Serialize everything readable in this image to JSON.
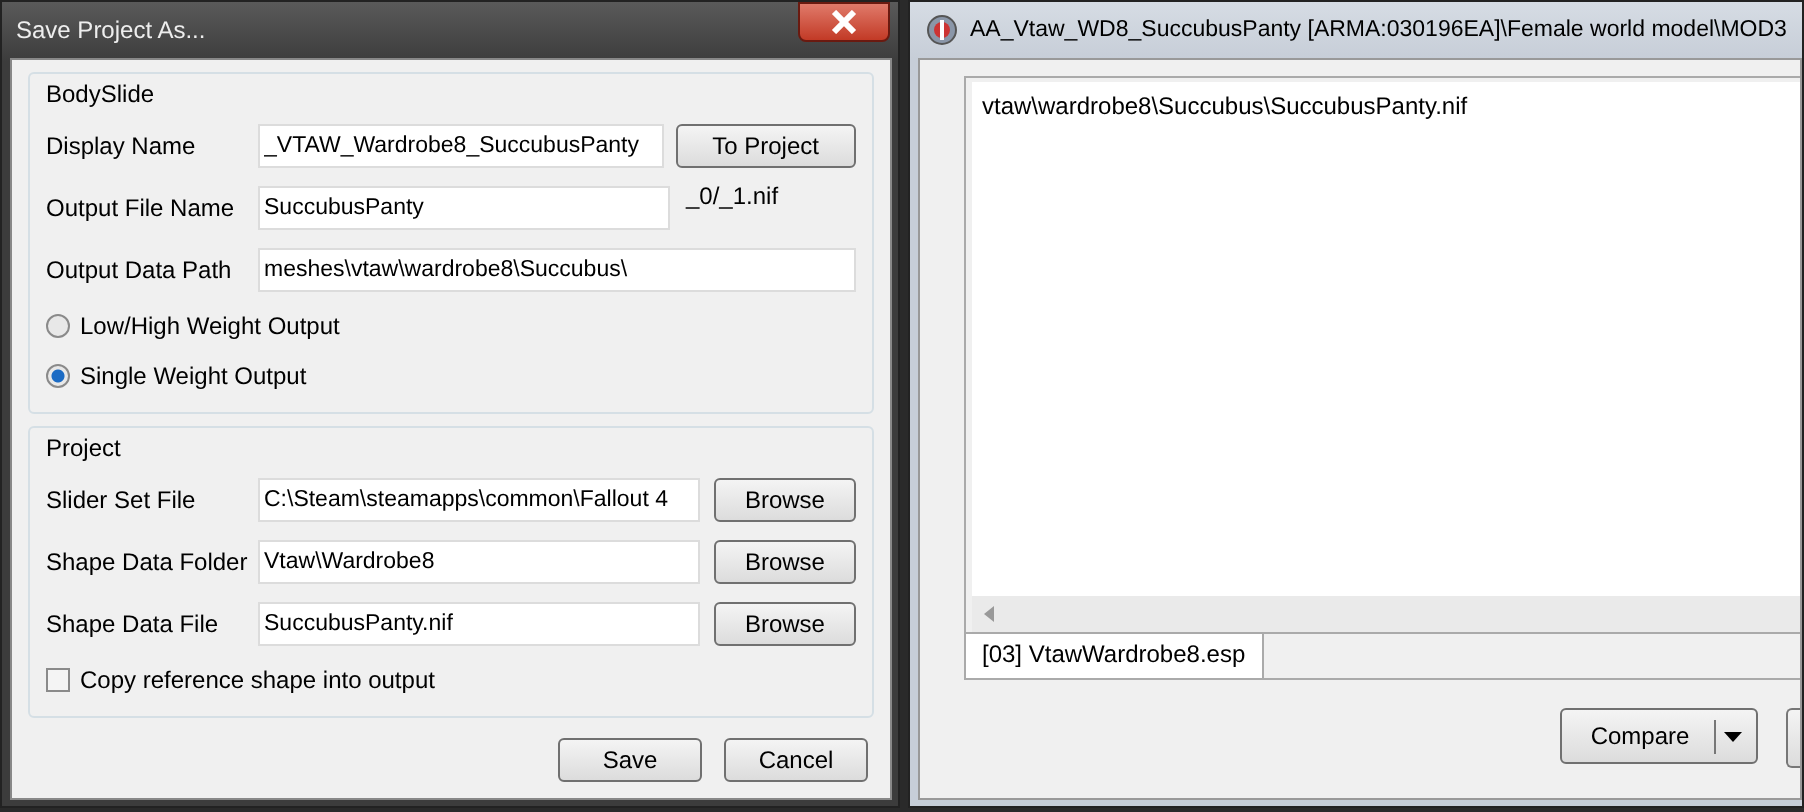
{
  "dialog": {
    "title": "Save Project As...",
    "groups": [
      {
        "title": "BodySlide",
        "rows": [
          {
            "kind": "field",
            "label": "Display Name",
            "value": "_VTAW_Wardrobe8_SuccubusPanty",
            "button": "To Project"
          },
          {
            "kind": "field",
            "label": "Output File Name",
            "value": "SuccubusPanty",
            "suffix": "_0/_1.nif"
          },
          {
            "kind": "field",
            "label": "Output Data Path",
            "value": "meshes\\vtaw\\wardrobe8\\Succubus\\"
          },
          {
            "kind": "radio",
            "label": "Low/High Weight Output",
            "selected": false
          },
          {
            "kind": "radio",
            "label": "Single Weight Output",
            "selected": true
          }
        ]
      },
      {
        "title": "Project",
        "rows": [
          {
            "kind": "field",
            "label": "Slider Set File",
            "value": "C:\\Steam\\steamapps\\common\\Fallout 4",
            "button": "Browse"
          },
          {
            "kind": "field",
            "label": "Shape Data Folder",
            "value": "Vtaw\\Wardrobe8",
            "button": "Browse"
          },
          {
            "kind": "field",
            "label": "Shape Data File",
            "value": "SuccubusPanty.nif",
            "button": "Browse"
          },
          {
            "kind": "checkbox",
            "label": "Copy reference shape into output",
            "checked": false
          }
        ]
      }
    ],
    "buttons": [
      "Save",
      "Cancel"
    ]
  },
  "viewer": {
    "title": "AA_Vtaw_WD8_SuccubusPanty [ARMA:030196EA]\\Female world model\\MOD3",
    "text": "vtaw\\wardrobe8\\Succubus\\SuccubusPanty.nif",
    "tabs": [
      {
        "label": "[03] VtawWardrobe8.esp",
        "selected": true
      }
    ],
    "button": "Compare"
  }
}
